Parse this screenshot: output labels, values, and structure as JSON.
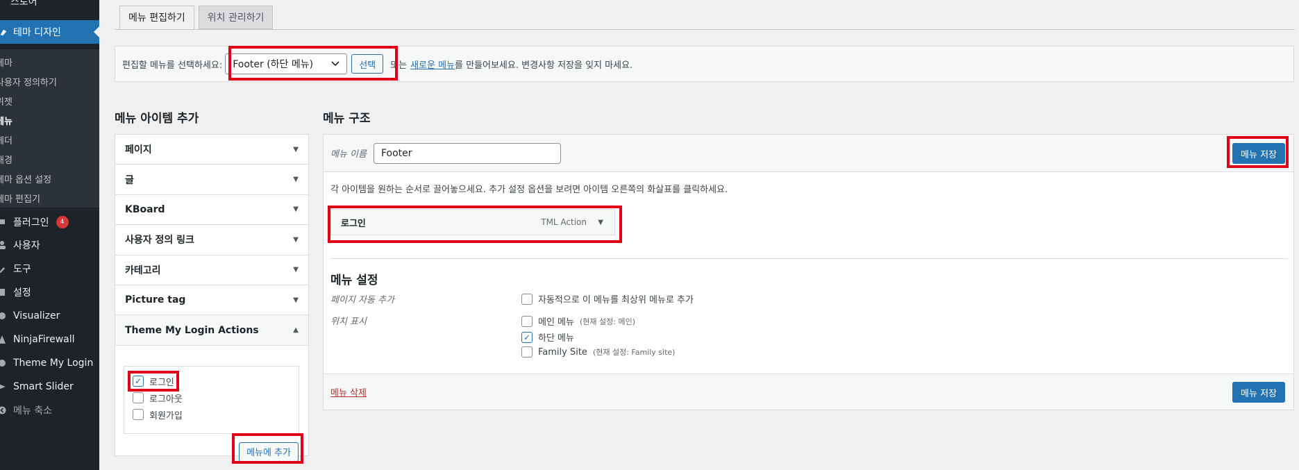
{
  "sidebar": {
    "top_item": "스토어",
    "active_menu": "테마 디자인",
    "submenu": [
      "테마",
      "사용자 정의하기",
      "위젯",
      "메뉴",
      "헤더",
      "배경",
      "테마 옵션 설정",
      "테마 편집기"
    ],
    "items": [
      {
        "label": "플러그인",
        "badge": "4"
      },
      {
        "label": "사용자"
      },
      {
        "label": "도구"
      },
      {
        "label": "설정"
      },
      {
        "label": "Visualizer"
      },
      {
        "label": "NinjaFirewall"
      },
      {
        "label": "Theme My Login"
      },
      {
        "label": "Smart Slider"
      }
    ],
    "collapse": "메뉴 축소"
  },
  "tabs": [
    "메뉴 편집하기",
    "위치 관리하기"
  ],
  "menu_select": {
    "label": "편집할 메뉴를 선택하세요:",
    "selected": "Footer (하단 메뉴)",
    "select_button": "선택",
    "or_text": "또는",
    "new_menu_link": "새로운 메뉴",
    "suffix": "를 만들어보세요. 변경사항 저장을 잊지 마세요."
  },
  "add_items": {
    "title": "메뉴 아이템 추가",
    "sections": [
      "페이지",
      "글",
      "KBoard",
      "사용자 정의 링크",
      "카테고리",
      "Picture tag",
      "Theme My Login Actions"
    ],
    "tml_actions": [
      {
        "label": "로그인",
        "checked": true
      },
      {
        "label": "로그아웃",
        "checked": false
      },
      {
        "label": "회원가입",
        "checked": false
      }
    ],
    "add_button": "메뉴에 추가"
  },
  "structure": {
    "title": "메뉴 구조",
    "name_label": "메뉴 이름",
    "name_value": "Footer",
    "save_button": "메뉴 저장",
    "hint": "각 아이템을 원하는 순서로 끌어놓으세요. 추가 설정 옵션을 보려면 아이템 오른쪽의 화살표를 클릭하세요.",
    "menu_item": {
      "label": "로그인",
      "type": "TML Action"
    },
    "settings_title": "메뉴 설정",
    "auto_add_label": "페이지 자동 추가",
    "auto_add_option": "자동적으로 이 메뉴를 최상위 메뉴로 추가",
    "location_label": "위치 표시",
    "locations": [
      {
        "label": "메인 메뉴",
        "note": "(현재 설정: 메인)",
        "checked": false
      },
      {
        "label": "하단 메뉴",
        "note": "",
        "checked": true
      },
      {
        "label": "Family Site",
        "note": "(현재 설정: Family site)",
        "checked": false
      }
    ],
    "delete_link": "메뉴 삭제"
  },
  "colors": {
    "accent": "#2271b1",
    "highlight": "#e00017",
    "sidebar": "#1d2327"
  }
}
